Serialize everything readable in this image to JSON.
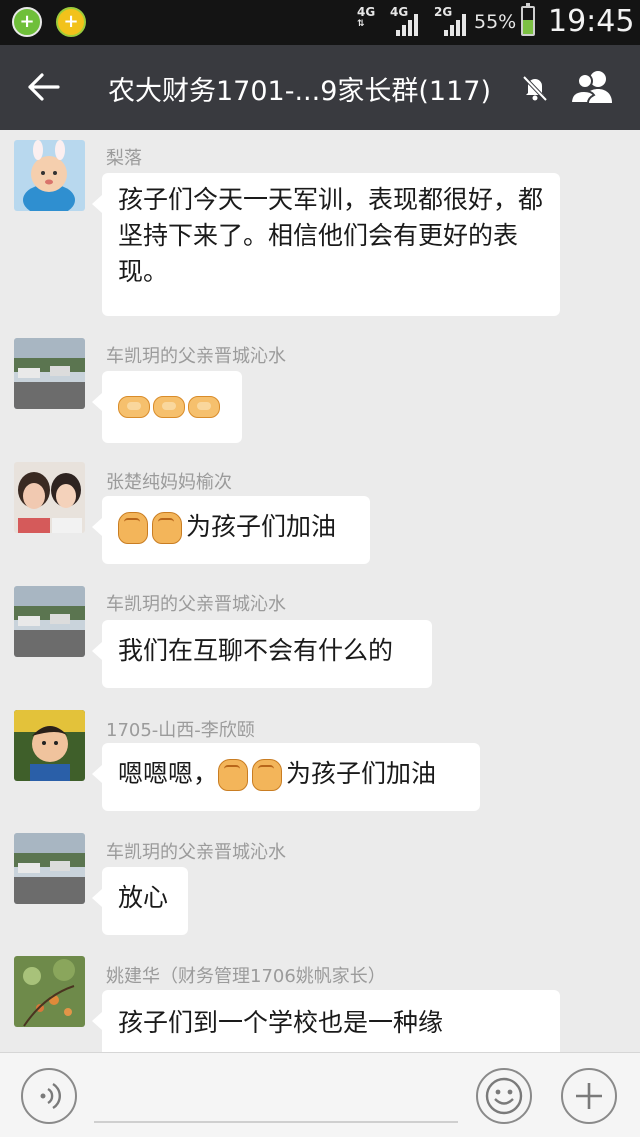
{
  "status_bar": {
    "network1": "4G",
    "network2": "4G",
    "network3": "2G",
    "battery_percent": "55%",
    "battery_level": 0.55,
    "time": "19:45"
  },
  "header": {
    "title": "农大财务1701-...9家长群(117)",
    "icons": [
      "back-arrow-icon",
      "mute-bell-icon",
      "group-members-icon"
    ]
  },
  "messages": [
    {
      "sender": "梨落",
      "text": "孩子们今天一天军训，表现都很好，都坚持下来了。相信他们会有更好的表现。"
    },
    {
      "sender": "车凯玥的父亲晋城沁水",
      "emojis": [
        "handshake-emoji",
        "handshake-emoji",
        "handshake-emoji"
      ]
    },
    {
      "sender": "张楚纯妈妈榆次",
      "emojis": [
        "fist-emoji",
        "fist-emoji"
      ],
      "text": "为孩子们加油"
    },
    {
      "sender": "车凯玥的父亲晋城沁水",
      "text": "我们在互聊不会有什么的"
    },
    {
      "sender": "1705-山西-李欣颐",
      "text_before": "嗯嗯嗯，",
      "emojis": [
        "fist-emoji",
        "fist-emoji"
      ],
      "text": "为孩子们加油"
    },
    {
      "sender": "车凯玥的父亲晋城沁水",
      "text": "放心"
    },
    {
      "sender": "姚建华（财务管理1706姚帆家长）",
      "text": "孩子们到一个学校也是一种缘"
    }
  ],
  "input_bar": {
    "icons": [
      "voice-icon",
      "emoji-face-icon",
      "plus-icon"
    ],
    "placeholder": ""
  },
  "colors": {
    "header_bg": "#393a3f",
    "chat_bg": "#ebebeb",
    "bubble_bg": "#ffffff",
    "sender_text": "#9b9b9b"
  }
}
